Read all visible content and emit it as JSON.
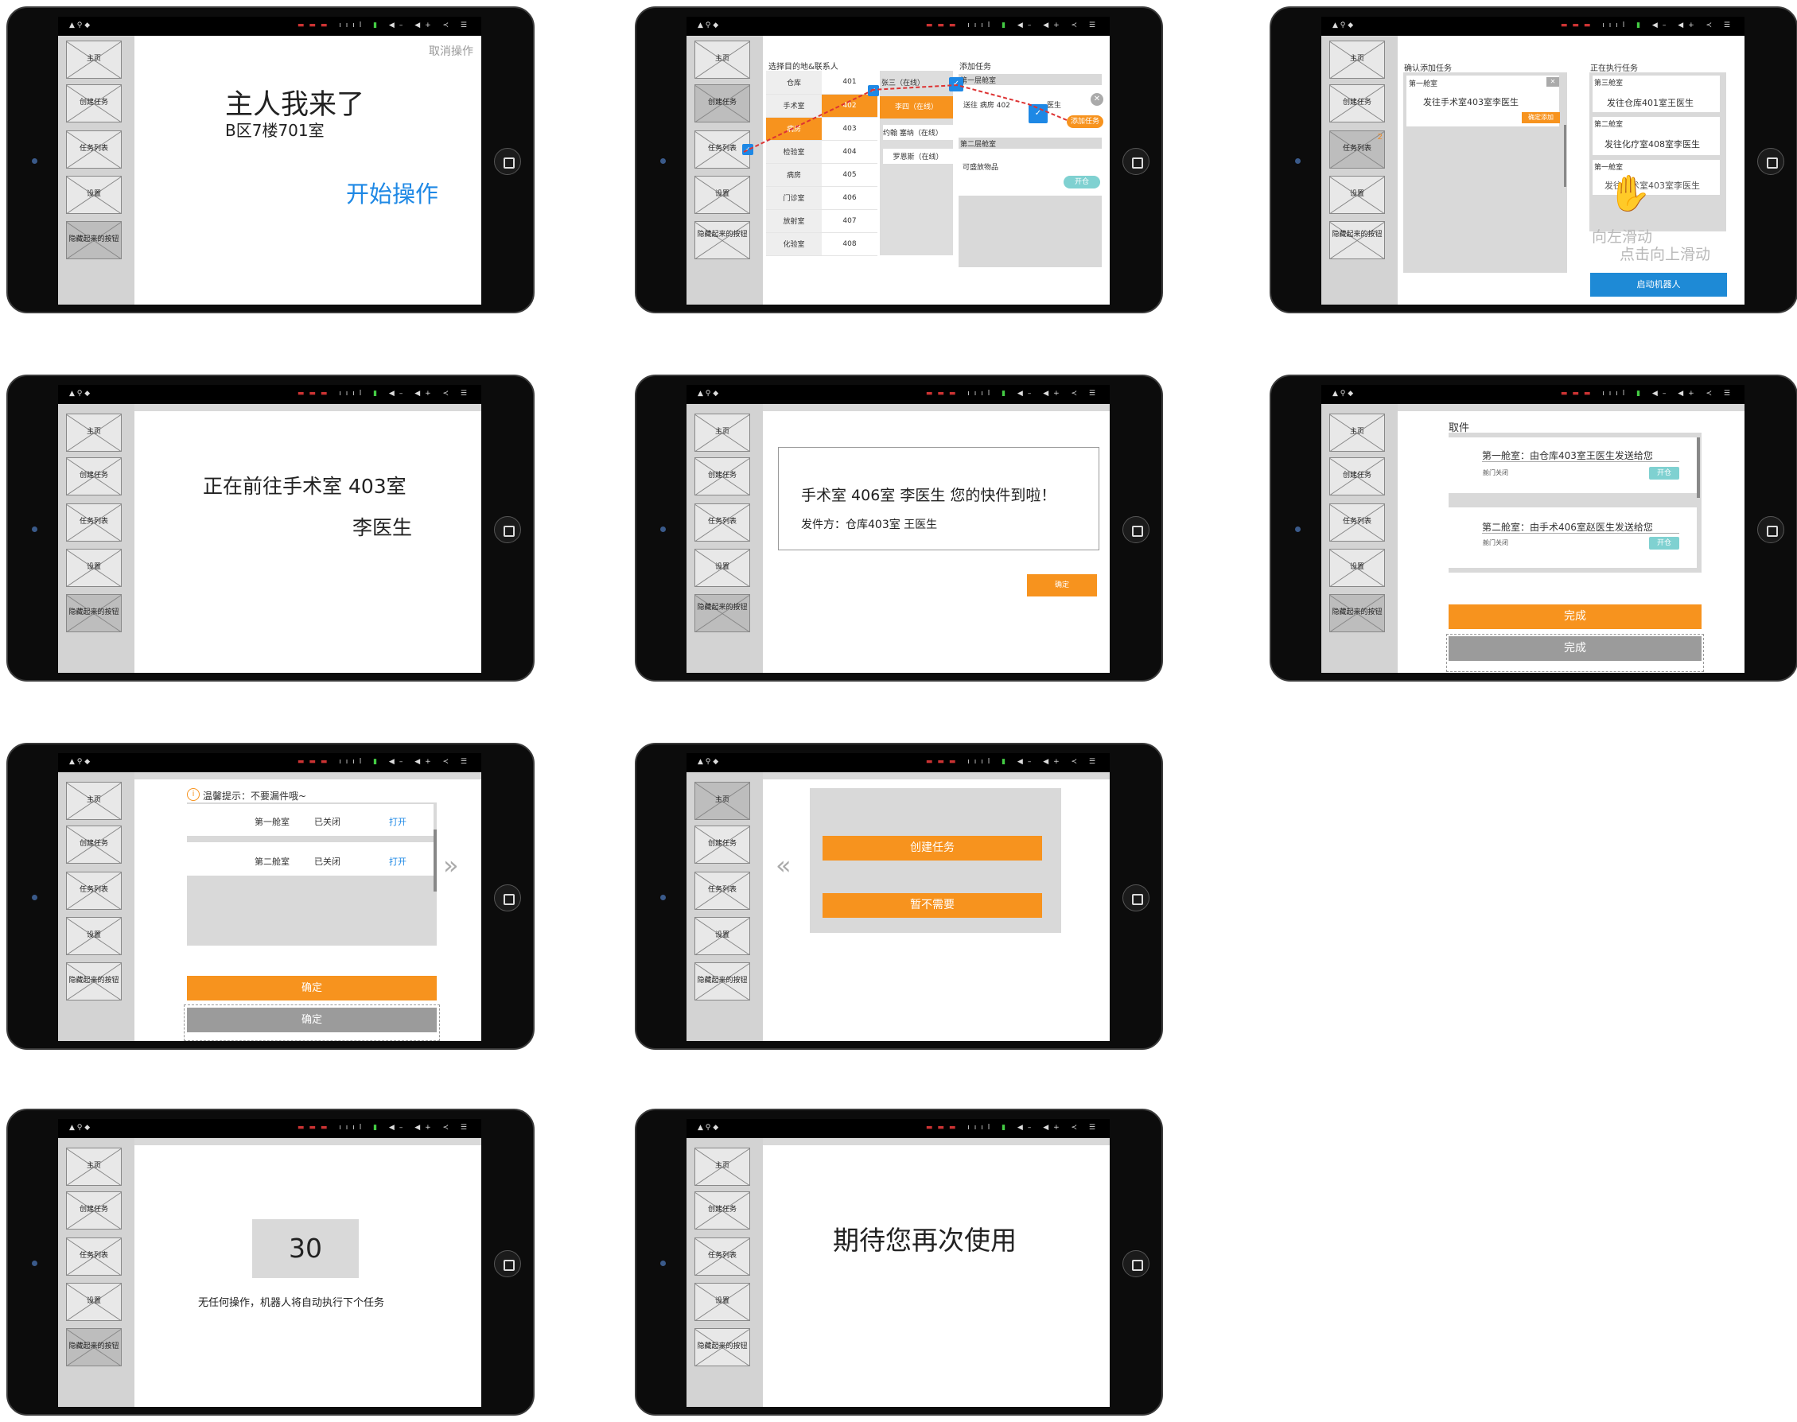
{
  "common": {
    "status_left": "▲  ⚲  ◆",
    "status_right_red": "▬▬▬",
    "status_right_mid": "ıııl",
    "status_right_green": "▮",
    "status_right_end": "◀–  ◀+  ≺  ☰",
    "nav": [
      "主页",
      "创建任务",
      "任务列表",
      "设置",
      "隐藏起来的按钮"
    ]
  },
  "s1": {
    "cancel": "取消操作",
    "greeting": "主人我来了",
    "location": "B区7楼701室",
    "start": "开始操作"
  },
  "s2": {
    "dest_title": "选择目的地&联系人",
    "rooms": [
      {
        "name": "仓库",
        "num": "401"
      },
      {
        "name": "手术室",
        "num": "402"
      },
      {
        "name": "病房",
        "num": "403"
      },
      {
        "name": "检验室",
        "num": "404"
      },
      {
        "name": "病房",
        "num": "405"
      },
      {
        "name": "门诊室",
        "num": "406"
      },
      {
        "name": "放射室",
        "num": "407"
      },
      {
        "name": "化验室",
        "num": "408"
      }
    ],
    "contacts": [
      "张三（在线）",
      "李四（在线）",
      "约翰 塞纳（在线）",
      "罗恩斯（在线）"
    ],
    "add_task_title": "添加任务",
    "layer1": "第一层舱室",
    "send_text": "送往 病房 402",
    "doctor_suffix": "医生",
    "add_btn": "添加任务",
    "layer2": "第二层舱室",
    "deliverable": "可盛放物品",
    "open_btn": "开仓"
  },
  "s3": {
    "confirm_title": "确认添加任务",
    "cabin1": "第一舱室",
    "task_text": "发往手术室403室李医生",
    "confirm_btn": "确定添加",
    "badge": "2",
    "executing_title": "正在执行任务",
    "exec": [
      {
        "cabin": "第三舱室",
        "task": "发往仓库401室王医生"
      },
      {
        "cabin": "第二舱室",
        "task": "发往化疗室408室李医生"
      },
      {
        "cabin": "第一舱室",
        "task": "发往手术室403室李医生"
      }
    ],
    "hint1": "向左滑动",
    "hint2": "点击向上滑动",
    "start_robot": "启动机器人"
  },
  "s4": {
    "line1": "正在前往手术室 403室",
    "line2": "李医生"
  },
  "s5": {
    "msg": "手术室 406室 李医生 您的快件到啦！",
    "sender": "发件方：仓库403室 王医生",
    "confirm": "确定"
  },
  "s6": {
    "title": "取件",
    "item1": "第一舱室：由仓库403室王医生发送给您",
    "item2": "第二舱室：由手术406室赵医生发送给您",
    "door_closed": "舱门关闭",
    "open_btn": "开仓",
    "done": "完成"
  },
  "s7": {
    "tip": "温馨提示：不要漏件哦~",
    "rows": [
      {
        "cabin": "第一舱室",
        "status": "已关闭",
        "action": "打开"
      },
      {
        "cabin": "第二舱室",
        "status": "已关闭",
        "action": "打开"
      }
    ],
    "confirm": "确定"
  },
  "s8": {
    "create": "创建任务",
    "no_need": "暂不需要"
  },
  "s9": {
    "count": "30",
    "note": "无任何操作，机器人将自动执行下个任务"
  },
  "s10": {
    "msg": "期待您再次使用"
  },
  "colors": {
    "orange": "#f7931e",
    "blue": "#1e88e5",
    "teal": "#7fd1d1",
    "gray": "#9b9b9b"
  }
}
